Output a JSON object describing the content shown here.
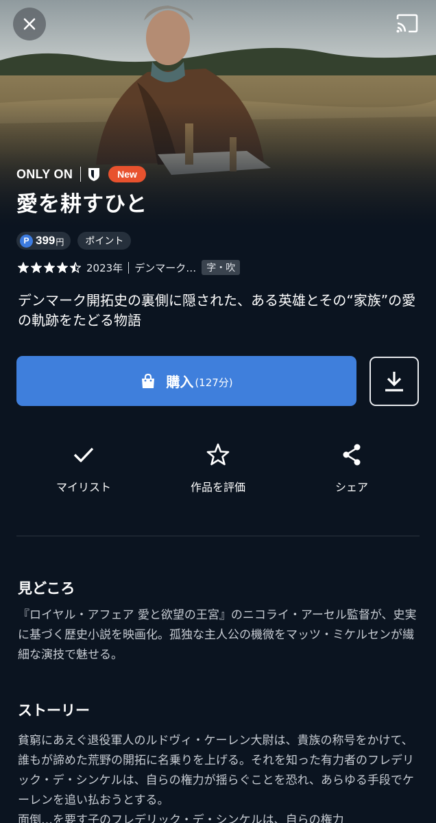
{
  "header": {
    "only_on": "ONLY ON",
    "new_badge": "New",
    "title": "愛を耕すひと"
  },
  "pricing": {
    "point_icon": "P",
    "price": "399",
    "unit": "円",
    "point_chip": "ポイント"
  },
  "meta": {
    "rating": 4.5,
    "year": "2023年",
    "country": "デンマーク…",
    "subtitle_chip": "字・吹"
  },
  "synopsis": "デンマーク開拓史の裏側に隠された、ある英雄とその“家族”の愛の軌跡をたどる物語",
  "buy": {
    "label": "購入",
    "duration": "(127分)",
    "accent": "#3f7fdc"
  },
  "actions": {
    "mylist": "マイリスト",
    "rate": "作品を評価",
    "share": "シェア"
  },
  "highlights": {
    "title": "見どころ",
    "body": "『ロイヤル・アフェア 愛と欲望の王宮』のニコライ・アーセル監督が、史実に基づく歴史小説を映画化。孤独な主人公の機微をマッツ・ミケルセンが繊細な演技で魅せる。"
  },
  "story": {
    "title": "ストーリー",
    "body": "貧窮にあえぐ退役軍人のルドヴィ・ケーレン大尉は、貴族の称号をかけて、誰もが諦めた荒野の開拓に名乗りを上げる。それを知った有力者のフレデリック・デ・シンケルは、自らの権力が揺らぐことを恐れ、あらゆる手段でケーレンを追い払おうとする。",
    "body_cutoff": "面倒…を要す子のフレデリック・デ・シンケルは、自らの権力"
  },
  "icons": [
    "close-icon",
    "cast-icon",
    "shield-icon",
    "point-icon",
    "star-icon",
    "shopping-bag-icon",
    "download-icon",
    "check-icon",
    "star-outline-icon",
    "share-icon"
  ],
  "colors": {
    "background": "#0b1420",
    "new_badge": "#e8522e",
    "point": "#3c7be0"
  }
}
